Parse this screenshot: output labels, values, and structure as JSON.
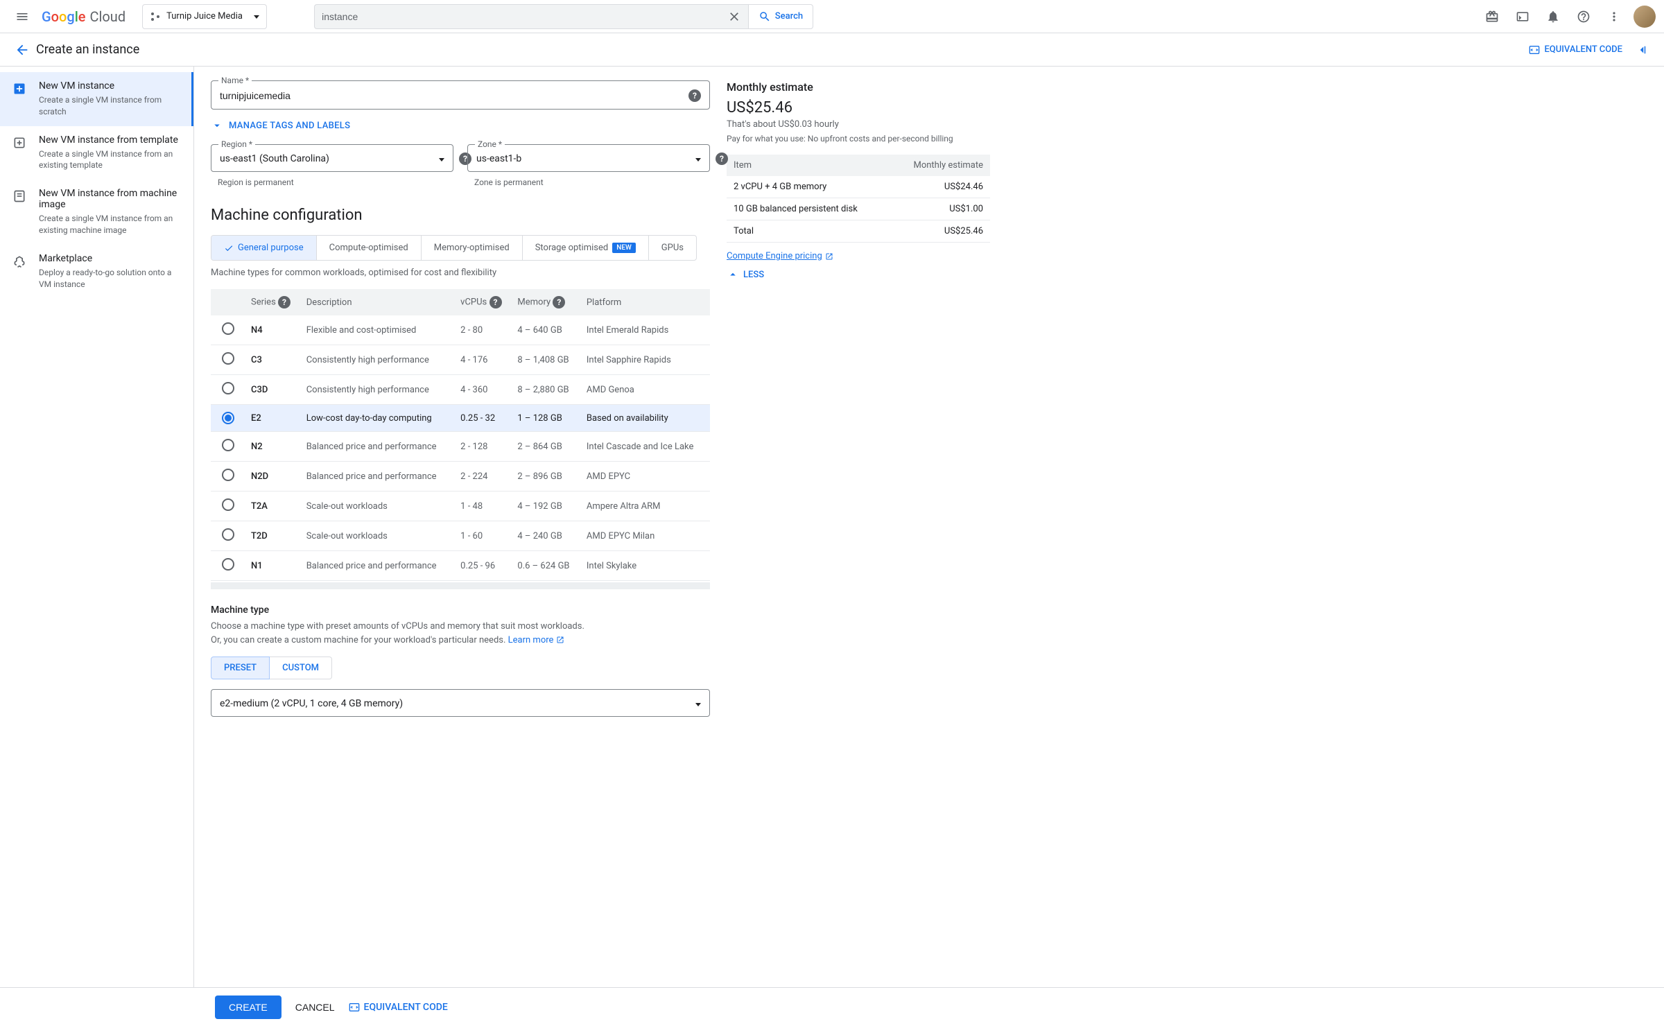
{
  "header": {
    "logo_text": "Cloud",
    "project": "Turnip Juice Media",
    "search_value": "instance",
    "search_button": "Search"
  },
  "page": {
    "title": "Create an instance",
    "equivalent_code": "EQUIVALENT CODE"
  },
  "left_nav": [
    {
      "title": "New VM instance",
      "desc": "Create a single VM instance from scratch",
      "selected": true
    },
    {
      "title": "New VM instance from template",
      "desc": "Create a single VM instance from an existing template"
    },
    {
      "title": "New VM instance from machine image",
      "desc": "Create a single VM instance from an existing machine image"
    },
    {
      "title": "Marketplace",
      "desc": "Deploy a ready-to-go solution onto a VM instance"
    }
  ],
  "form": {
    "name_label": "Name *",
    "name_value": "turnipjuicemedia",
    "manage_tags": "MANAGE TAGS AND LABELS",
    "region_label": "Region *",
    "region_value": "us-east1 (South Carolina)",
    "region_hint": "Region is permanent",
    "zone_label": "Zone *",
    "zone_value": "us-east1-b",
    "zone_hint": "Zone is permanent",
    "machine_config_title": "Machine configuration",
    "tabs": [
      {
        "label": "General purpose",
        "active": true
      },
      {
        "label": "Compute-optimised"
      },
      {
        "label": "Memory-optimised"
      },
      {
        "label": "Storage optimised",
        "badge": "NEW"
      },
      {
        "label": "GPUs"
      }
    ],
    "tab_desc": "Machine types for common workloads, optimised for cost and flexibility",
    "series_headers": {
      "series": "Series",
      "desc": "Description",
      "vcpus": "vCPUs",
      "memory": "Memory",
      "platform": "Platform"
    },
    "series_rows": [
      {
        "name": "N4",
        "desc": "Flexible and cost-optimised",
        "vcpus": "2 - 80",
        "memory": "4 – 640 GB",
        "platform": "Intel Emerald Rapids"
      },
      {
        "name": "C3",
        "desc": "Consistently high performance",
        "vcpus": "4 - 176",
        "memory": "8 – 1,408 GB",
        "platform": "Intel Sapphire Rapids"
      },
      {
        "name": "C3D",
        "desc": "Consistently high performance",
        "vcpus": "4 - 360",
        "memory": "8 – 2,880 GB",
        "platform": "AMD Genoa"
      },
      {
        "name": "E2",
        "desc": "Low-cost day-to-day computing",
        "vcpus": "0.25 - 32",
        "memory": "1 – 128 GB",
        "platform": "Based on availability",
        "selected": true
      },
      {
        "name": "N2",
        "desc": "Balanced price and performance",
        "vcpus": "2 - 128",
        "memory": "2 – 864 GB",
        "platform": "Intel Cascade and Ice Lake"
      },
      {
        "name": "N2D",
        "desc": "Balanced price and performance",
        "vcpus": "2 - 224",
        "memory": "2 – 896 GB",
        "platform": "AMD EPYC"
      },
      {
        "name": "T2A",
        "desc": "Scale-out workloads",
        "vcpus": "1 - 48",
        "memory": "4 – 192 GB",
        "platform": "Ampere Altra ARM"
      },
      {
        "name": "T2D",
        "desc": "Scale-out workloads",
        "vcpus": "1 - 60",
        "memory": "4 – 240 GB",
        "platform": "AMD EPYC Milan"
      },
      {
        "name": "N1",
        "desc": "Balanced price and performance",
        "vcpus": "0.25 - 96",
        "memory": "0.6 – 624 GB",
        "platform": "Intel Skylake"
      }
    ],
    "machine_type_title": "Machine type",
    "machine_type_desc1": "Choose a machine type with preset amounts of vCPUs and memory that suit most workloads.",
    "machine_type_desc2": "Or, you can create a custom machine for your workload's particular needs. ",
    "learn_more": "Learn more",
    "preset": "PRESET",
    "custom": "CUSTOM",
    "machine_type_value": "e2-medium (2 vCPU, 1 core, 4 GB memory)"
  },
  "estimate": {
    "title": "Monthly estimate",
    "price": "US$25.46",
    "hourly": "That's about US$0.03 hourly",
    "note": "Pay for what you use: No upfront costs and per-second billing",
    "th_item": "Item",
    "th_est": "Monthly estimate",
    "rows": [
      {
        "item": "2 vCPU + 4 GB memory",
        "cost": "US$24.46"
      },
      {
        "item": "10 GB balanced persistent disk",
        "cost": "US$1.00"
      },
      {
        "item": "Total",
        "cost": "US$25.46"
      }
    ],
    "pricing_link": "Compute Engine pricing",
    "less": "LESS"
  },
  "footer": {
    "create": "CREATE",
    "cancel": "CANCEL",
    "code": "EQUIVALENT CODE"
  }
}
